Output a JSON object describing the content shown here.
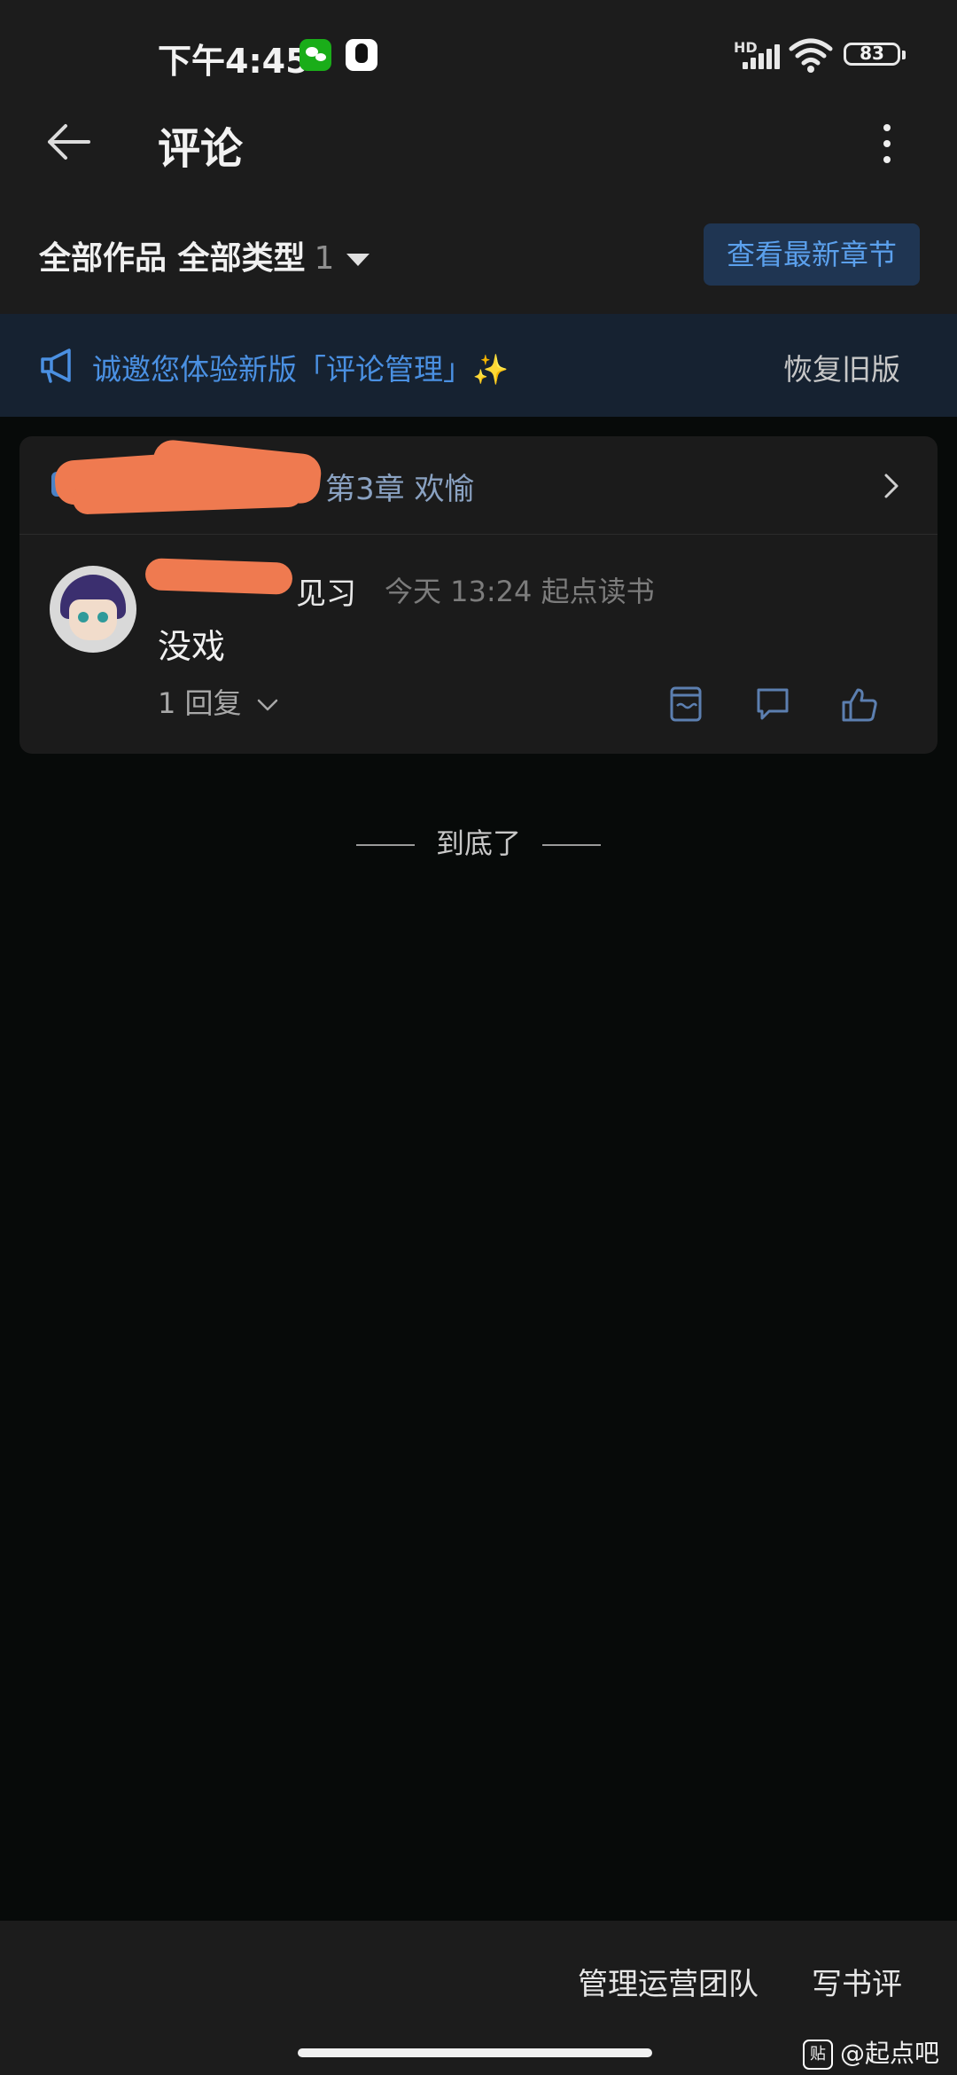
{
  "status": {
    "time": "下午4:45",
    "network": "HD",
    "battery": "83"
  },
  "header": {
    "title": "评论"
  },
  "filter": {
    "label": "全部作品 全部类型",
    "count": "1",
    "latest_button": "查看最新章节"
  },
  "banner": {
    "text": "诚邀您体验新版「评论管理」✨",
    "restore": "恢复旧版"
  },
  "comment_card": {
    "chapter_title": "第3章 欢愉",
    "user_suffix": "见习",
    "timestamp_source": "今天 13:24  起点读书",
    "content": "没戏",
    "replies": "1 回复"
  },
  "end_text": "到底了",
  "bottom_bar": {
    "manage_team": "管理运营团队",
    "write_review": "写书评"
  },
  "watermark": {
    "icon": "贴",
    "text": "@起点吧"
  },
  "colors": {
    "accent": "#4a90e2",
    "redaction": "#ef7a50",
    "background": "#070a09",
    "surface": "#1b1b1b"
  }
}
